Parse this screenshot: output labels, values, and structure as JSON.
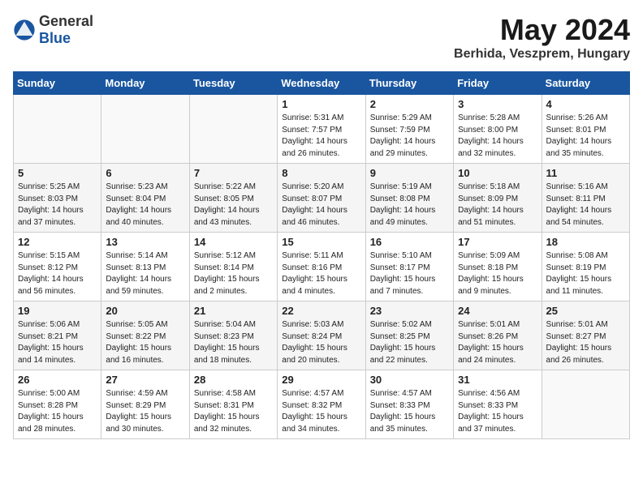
{
  "header": {
    "logo_general": "General",
    "logo_blue": "Blue",
    "month_title": "May 2024",
    "location": "Berhida, Veszprem, Hungary"
  },
  "weekdays": [
    "Sunday",
    "Monday",
    "Tuesday",
    "Wednesday",
    "Thursday",
    "Friday",
    "Saturday"
  ],
  "weeks": [
    [
      {
        "day": "",
        "info": ""
      },
      {
        "day": "",
        "info": ""
      },
      {
        "day": "",
        "info": ""
      },
      {
        "day": "1",
        "info": "Sunrise: 5:31 AM\nSunset: 7:57 PM\nDaylight: 14 hours\nand 26 minutes."
      },
      {
        "day": "2",
        "info": "Sunrise: 5:29 AM\nSunset: 7:59 PM\nDaylight: 14 hours\nand 29 minutes."
      },
      {
        "day": "3",
        "info": "Sunrise: 5:28 AM\nSunset: 8:00 PM\nDaylight: 14 hours\nand 32 minutes."
      },
      {
        "day": "4",
        "info": "Sunrise: 5:26 AM\nSunset: 8:01 PM\nDaylight: 14 hours\nand 35 minutes."
      }
    ],
    [
      {
        "day": "5",
        "info": "Sunrise: 5:25 AM\nSunset: 8:03 PM\nDaylight: 14 hours\nand 37 minutes."
      },
      {
        "day": "6",
        "info": "Sunrise: 5:23 AM\nSunset: 8:04 PM\nDaylight: 14 hours\nand 40 minutes."
      },
      {
        "day": "7",
        "info": "Sunrise: 5:22 AM\nSunset: 8:05 PM\nDaylight: 14 hours\nand 43 minutes."
      },
      {
        "day": "8",
        "info": "Sunrise: 5:20 AM\nSunset: 8:07 PM\nDaylight: 14 hours\nand 46 minutes."
      },
      {
        "day": "9",
        "info": "Sunrise: 5:19 AM\nSunset: 8:08 PM\nDaylight: 14 hours\nand 49 minutes."
      },
      {
        "day": "10",
        "info": "Sunrise: 5:18 AM\nSunset: 8:09 PM\nDaylight: 14 hours\nand 51 minutes."
      },
      {
        "day": "11",
        "info": "Sunrise: 5:16 AM\nSunset: 8:11 PM\nDaylight: 14 hours\nand 54 minutes."
      }
    ],
    [
      {
        "day": "12",
        "info": "Sunrise: 5:15 AM\nSunset: 8:12 PM\nDaylight: 14 hours\nand 56 minutes."
      },
      {
        "day": "13",
        "info": "Sunrise: 5:14 AM\nSunset: 8:13 PM\nDaylight: 14 hours\nand 59 minutes."
      },
      {
        "day": "14",
        "info": "Sunrise: 5:12 AM\nSunset: 8:14 PM\nDaylight: 15 hours\nand 2 minutes."
      },
      {
        "day": "15",
        "info": "Sunrise: 5:11 AM\nSunset: 8:16 PM\nDaylight: 15 hours\nand 4 minutes."
      },
      {
        "day": "16",
        "info": "Sunrise: 5:10 AM\nSunset: 8:17 PM\nDaylight: 15 hours\nand 7 minutes."
      },
      {
        "day": "17",
        "info": "Sunrise: 5:09 AM\nSunset: 8:18 PM\nDaylight: 15 hours\nand 9 minutes."
      },
      {
        "day": "18",
        "info": "Sunrise: 5:08 AM\nSunset: 8:19 PM\nDaylight: 15 hours\nand 11 minutes."
      }
    ],
    [
      {
        "day": "19",
        "info": "Sunrise: 5:06 AM\nSunset: 8:21 PM\nDaylight: 15 hours\nand 14 minutes."
      },
      {
        "day": "20",
        "info": "Sunrise: 5:05 AM\nSunset: 8:22 PM\nDaylight: 15 hours\nand 16 minutes."
      },
      {
        "day": "21",
        "info": "Sunrise: 5:04 AM\nSunset: 8:23 PM\nDaylight: 15 hours\nand 18 minutes."
      },
      {
        "day": "22",
        "info": "Sunrise: 5:03 AM\nSunset: 8:24 PM\nDaylight: 15 hours\nand 20 minutes."
      },
      {
        "day": "23",
        "info": "Sunrise: 5:02 AM\nSunset: 8:25 PM\nDaylight: 15 hours\nand 22 minutes."
      },
      {
        "day": "24",
        "info": "Sunrise: 5:01 AM\nSunset: 8:26 PM\nDaylight: 15 hours\nand 24 minutes."
      },
      {
        "day": "25",
        "info": "Sunrise: 5:01 AM\nSunset: 8:27 PM\nDaylight: 15 hours\nand 26 minutes."
      }
    ],
    [
      {
        "day": "26",
        "info": "Sunrise: 5:00 AM\nSunset: 8:28 PM\nDaylight: 15 hours\nand 28 minutes."
      },
      {
        "day": "27",
        "info": "Sunrise: 4:59 AM\nSunset: 8:29 PM\nDaylight: 15 hours\nand 30 minutes."
      },
      {
        "day": "28",
        "info": "Sunrise: 4:58 AM\nSunset: 8:31 PM\nDaylight: 15 hours\nand 32 minutes."
      },
      {
        "day": "29",
        "info": "Sunrise: 4:57 AM\nSunset: 8:32 PM\nDaylight: 15 hours\nand 34 minutes."
      },
      {
        "day": "30",
        "info": "Sunrise: 4:57 AM\nSunset: 8:33 PM\nDaylight: 15 hours\nand 35 minutes."
      },
      {
        "day": "31",
        "info": "Sunrise: 4:56 AM\nSunset: 8:33 PM\nDaylight: 15 hours\nand 37 minutes."
      },
      {
        "day": "",
        "info": ""
      }
    ]
  ]
}
